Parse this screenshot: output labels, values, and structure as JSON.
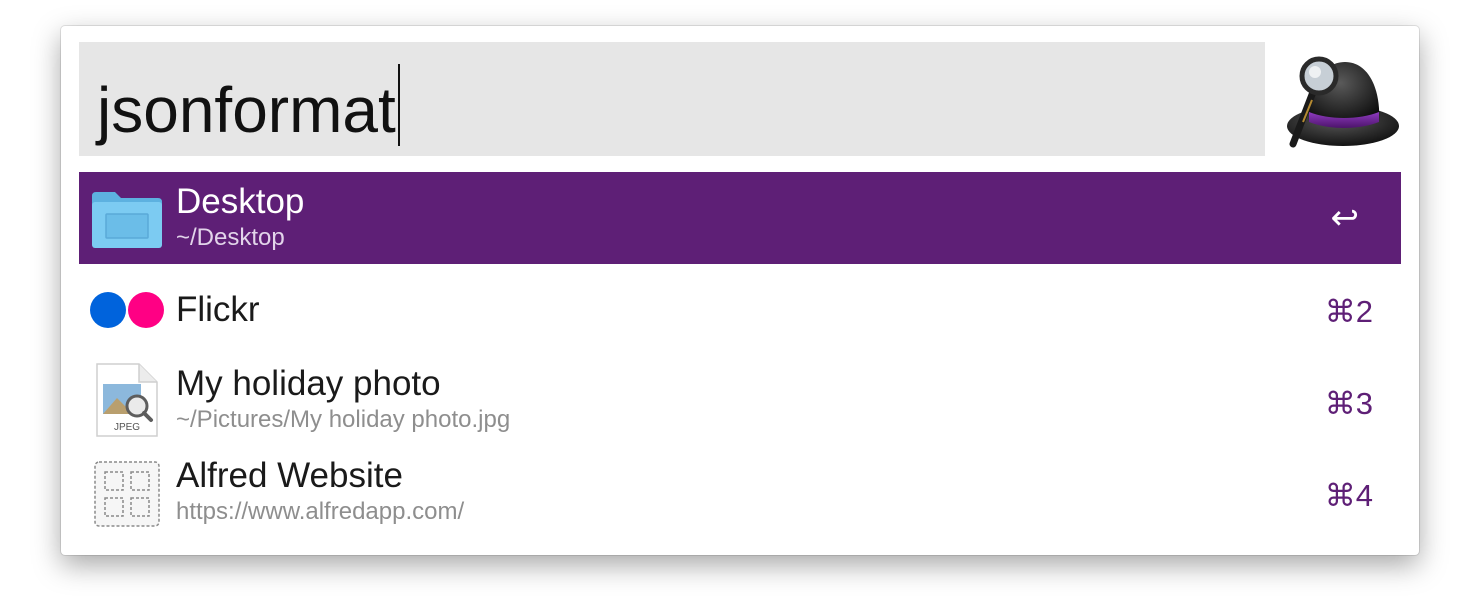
{
  "search": {
    "query": "jsonformat"
  },
  "app": {
    "icon": "alfred-hat-icon"
  },
  "results": [
    {
      "title": "Desktop",
      "subtitle": "~/Desktop",
      "shortcut": "↩",
      "icon": "folder-icon",
      "selected": true
    },
    {
      "title": "Flickr",
      "subtitle": "",
      "shortcut": "⌘2",
      "icon": "flickr-icon",
      "selected": false
    },
    {
      "title": "My holiday photo",
      "subtitle": "~/Pictures/My holiday photo.jpg",
      "shortcut": "⌘3",
      "icon": "jpeg-file-icon",
      "icon_label": "JPEG",
      "selected": false
    },
    {
      "title": "Alfred Website",
      "subtitle": "https://www.alfredapp.com/",
      "shortcut": "⌘4",
      "icon": "web-bookmark-icon",
      "selected": false
    }
  ],
  "colors": {
    "selection": "#5e1f76",
    "flickr_blue": "#0063dc",
    "flickr_pink": "#ff0084",
    "search_bg": "#e6e6e6"
  }
}
